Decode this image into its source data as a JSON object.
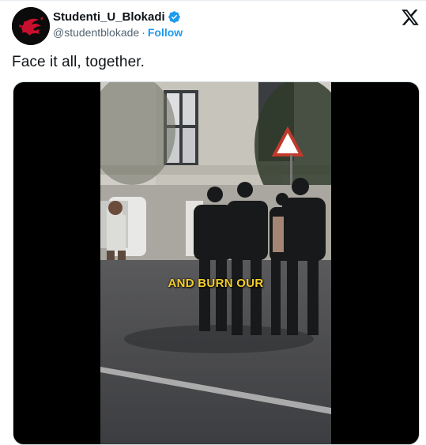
{
  "tweet": {
    "author": {
      "display_name": "Studenti_U_Blokadi",
      "handle": "@studentblokade",
      "verified": true,
      "verified_icon": "verified-badge-icon",
      "verified_color": "#1d9bf0"
    },
    "separator": "·",
    "follow_label": "Follow",
    "follow_color": "#1d9bf0",
    "platform_icon": "x-logo-icon",
    "text": "Face it all, together.",
    "media": {
      "type": "video",
      "caption": "AND BURN OUR",
      "caption_color": "#f5cf2a"
    }
  }
}
